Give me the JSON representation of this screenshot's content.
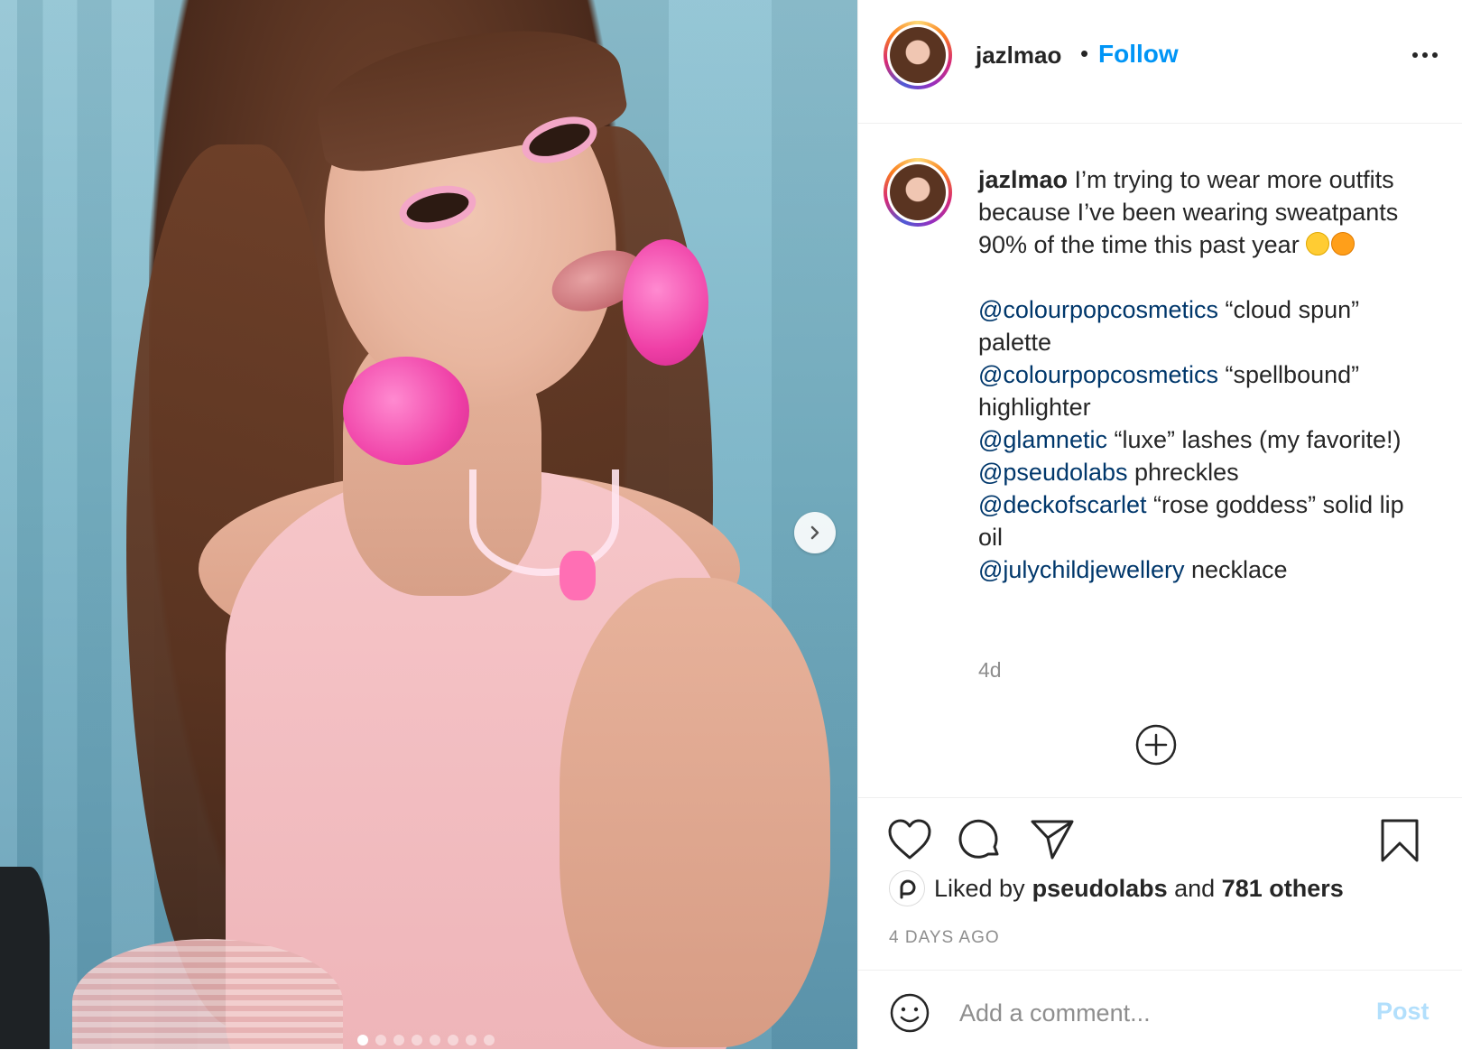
{
  "post": {
    "username": "jazlmao",
    "separator": "•",
    "follow_label": "Follow",
    "more_icon": "more-dots-icon"
  },
  "caption": {
    "username": "jazlmao",
    "text": " I’m trying to wear more outfits because I’ve been wearing sweatpants 90% of the time this past year",
    "lines": [
      {
        "mention": "@colourpopcosmetics",
        "rest": " “cloud spun” palette"
      },
      {
        "mention": "@colourpopcosmetics",
        "rest": " “spellbound” highlighter"
      },
      {
        "mention": "@glamnetic",
        "rest": " “luxe” lashes (my favorite!)"
      },
      {
        "mention": "@pseudolabs",
        "rest": " phreckles"
      },
      {
        "mention": "@deckofscarlet",
        "rest": " “rose goddess” solid lip oil"
      },
      {
        "mention": "@julychildjewellery",
        "rest": " necklace"
      }
    ],
    "time": "4d"
  },
  "likes": {
    "prefix": "Liked by ",
    "user": "pseudolabs",
    "middle": " and ",
    "count": "781 others"
  },
  "date_label": "4 DAYS AGO",
  "comment_box": {
    "placeholder": "Add a comment...",
    "post_label": "Post"
  },
  "carousel": {
    "slide_count": 8,
    "active_index": 0
  },
  "colors": {
    "accent": "#0095f6",
    "mention": "#00376b",
    "post_disabled": "#b2dffc",
    "muted": "#8e8e8e"
  }
}
